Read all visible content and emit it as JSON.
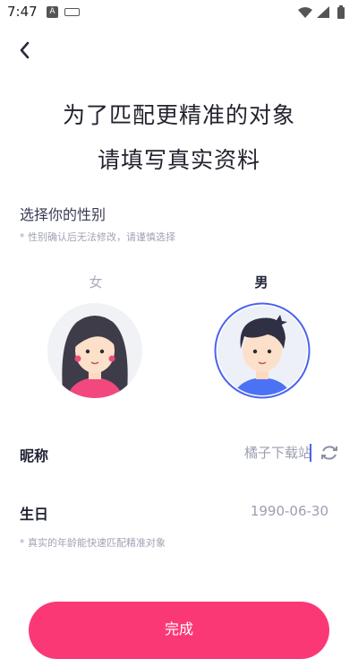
{
  "status_bar": {
    "time": "7:47",
    "a_badge": "A"
  },
  "header": {
    "title_line1": "为了匹配更精准的对象",
    "title_line2": "请填写真实资料"
  },
  "gender": {
    "title": "选择你的性别",
    "note": "* 性别确认后无法修改，请谨慎选择",
    "female_label": "女",
    "male_label": "男",
    "selected": "男"
  },
  "nickname": {
    "label": "昵称",
    "value": "橘子下载站"
  },
  "birthday": {
    "label": "生日",
    "value": "1990-06-30",
    "note": "* 真实的年龄能快速匹配精准对象"
  },
  "submit": {
    "label": "完成"
  },
  "colors": {
    "accent": "#fb3876",
    "selected_ring": "#4a63f0"
  }
}
